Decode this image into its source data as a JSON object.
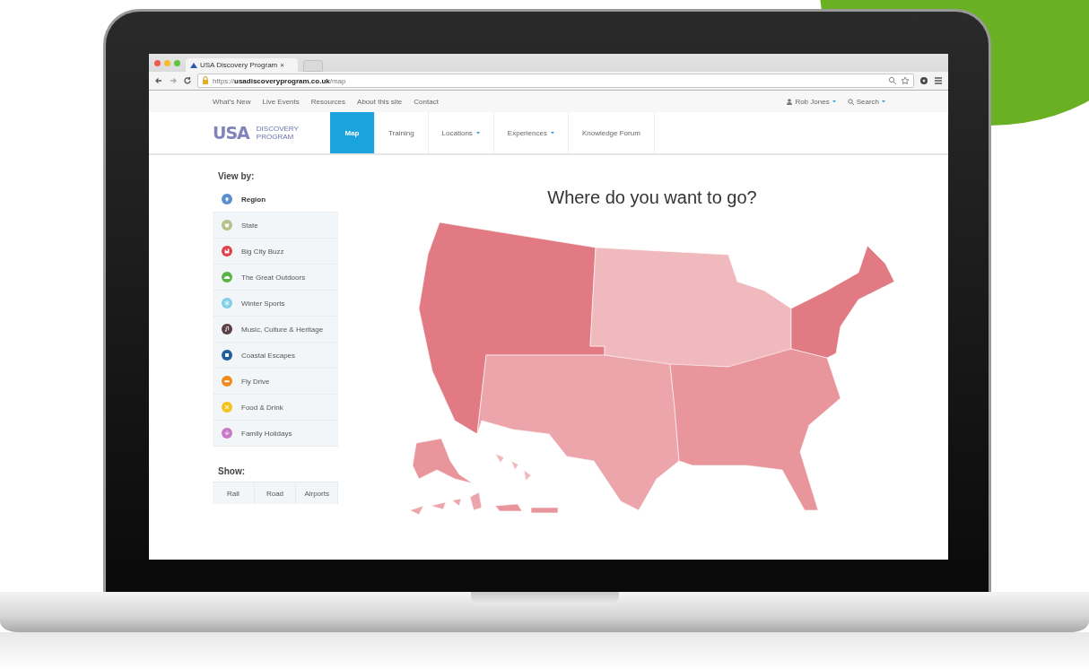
{
  "browser": {
    "tab_title": "USA Discovery Program",
    "tab_close": "×",
    "url": "https://**usadiscoveryprogram.co.uk**/map"
  },
  "top_links": [
    "What's New",
    "Live Events",
    "Resources",
    "About this site",
    "Contact"
  ],
  "user": {
    "name": "Rob Jones"
  },
  "search": {
    "label": "Search"
  },
  "logo": {
    "mark": "USA",
    "lines": [
      "DISCOVERY",
      "PROGRAM"
    ]
  },
  "nav": [
    {
      "label": "Map",
      "selected": true,
      "dropdown": false
    },
    {
      "label": "Training",
      "selected": false,
      "dropdown": false
    },
    {
      "label": "Locations",
      "selected": false,
      "dropdown": true
    },
    {
      "label": "Experiences",
      "selected": false,
      "dropdown": true
    },
    {
      "label": "Knowledge Forum",
      "selected": false,
      "dropdown": false
    }
  ],
  "view_by": {
    "title": "View by:",
    "items": [
      {
        "label": "Region",
        "color": "#5b8fd0",
        "selected": true
      },
      {
        "label": "State",
        "color": "#b7c08a",
        "selected": false
      },
      {
        "label": "Big City Buzz",
        "color": "#e0404a",
        "selected": false
      },
      {
        "label": "The Great Outdoors",
        "color": "#5cb345",
        "selected": false
      },
      {
        "label": "Winter Sports",
        "color": "#7fd0e6",
        "selected": false
      },
      {
        "label": "Music, Culture & Heritage",
        "color": "#5a3f45",
        "selected": false
      },
      {
        "label": "Coastal Escapes",
        "color": "#1f5f9e",
        "selected": false
      },
      {
        "label": "Fly Drive",
        "color": "#f08a1c",
        "selected": false
      },
      {
        "label": "Food & Drink",
        "color": "#f5c21c",
        "selected": false
      },
      {
        "label": "Family Holidays",
        "color": "#c87ac8",
        "selected": false
      }
    ]
  },
  "show": {
    "title": "Show:",
    "options": [
      "Rail",
      "Road",
      "Airports"
    ]
  },
  "heading": "Where do you want to go?"
}
